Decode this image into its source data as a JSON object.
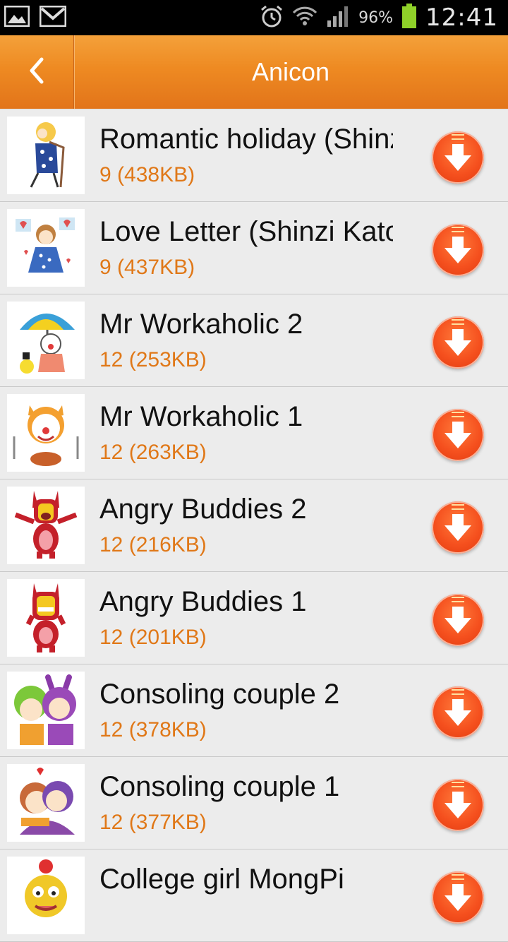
{
  "status_bar": {
    "battery_pct": "96%",
    "time": "12:41",
    "icons": [
      "image-icon",
      "gmail-icon",
      "alarm-icon",
      "wifi-icon",
      "signal-icon",
      "battery-icon"
    ]
  },
  "header": {
    "title": "Anicon",
    "back_icon": "chevron-left-icon"
  },
  "colors": {
    "header_orange": "#ee8a22",
    "meta_orange": "#e07818",
    "download_red": "#f5501e"
  },
  "items": [
    {
      "name": "Romantic holiday (Shinzi Katoh)",
      "meta": "9 (438KB)"
    },
    {
      "name": "Love Letter (Shinzi Katoh)",
      "meta": "9 (437KB)"
    },
    {
      "name": "Mr Workaholic 2",
      "meta": "12 (253KB)"
    },
    {
      "name": "Mr Workaholic 1",
      "meta": "12 (263KB)"
    },
    {
      "name": "Angry Buddies 2",
      "meta": "12 (216KB)"
    },
    {
      "name": "Angry Buddies 1",
      "meta": "12 (201KB)"
    },
    {
      "name": "Consoling couple 2",
      "meta": "12 (378KB)"
    },
    {
      "name": "Consoling couple 1",
      "meta": "12 (377KB)"
    },
    {
      "name": "College girl MongPi",
      "meta": ""
    }
  ]
}
